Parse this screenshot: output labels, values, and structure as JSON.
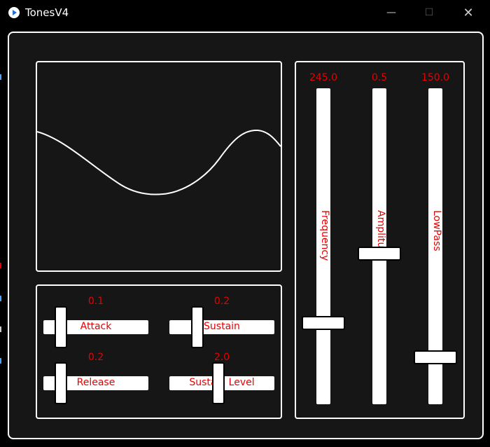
{
  "window": {
    "title": "TonesV4",
    "minimize_icon": "minimize-icon",
    "maximize_icon": "maximize-icon",
    "close_icon": "close-icon"
  },
  "envelope": {
    "attack": {
      "label": "Attack",
      "value": "0.1"
    },
    "sustain": {
      "label": "Sustain",
      "value": "0.2"
    },
    "release": {
      "label": "Release",
      "value": "0.2"
    },
    "sustain_level": {
      "label": "Sustain Level",
      "value": "2.0"
    }
  },
  "tone": {
    "frequency": {
      "label": "Frequency",
      "value": "245.0"
    },
    "amplitude": {
      "label": "Amplitude",
      "value": "0.5"
    },
    "lowpass": {
      "label": "LowPass",
      "value": "150.0"
    }
  },
  "colors": {
    "background": "#161616",
    "accent": "#e80000",
    "foreground": "#ffffff"
  }
}
